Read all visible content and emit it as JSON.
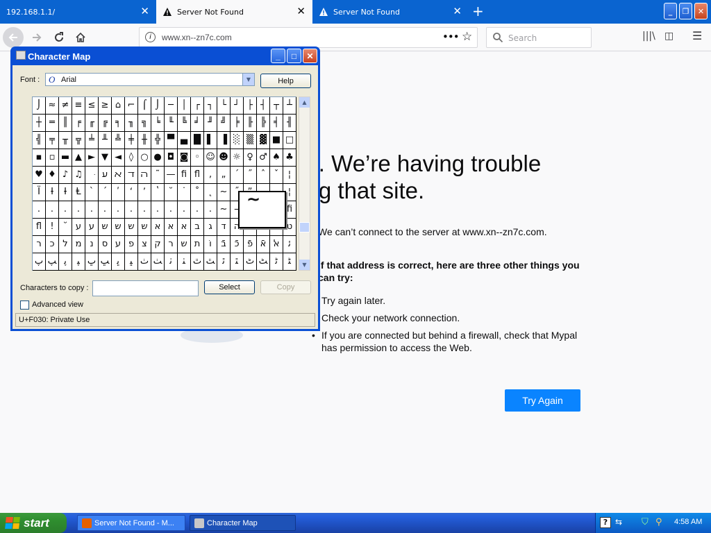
{
  "browser": {
    "tabs": [
      {
        "title": "192.168.1.1/",
        "selected": false
      },
      {
        "title": "Server Not Found",
        "selected": true
      },
      {
        "title": "Server Not Found",
        "selected": false
      }
    ],
    "new_tab_label": "+",
    "url": "www.xn--zn7c.com",
    "search_placeholder": "Search",
    "page_actions_label": "•••",
    "bookmark_star": "☆",
    "accent": "#0a84ff"
  },
  "error_page": {
    "title_line1": "Hmm. We’re having trouble",
    "title_line2": "finding that site.",
    "message": "We can’t connect to the server at www.xn--zn7c.com.",
    "heading": "If that address is correct, here are three other things you can try:",
    "suggestions": [
      "Try again later.",
      "Check your network connection.",
      "If you are connected but behind a firewall, check that Mypal has permission to access the Web."
    ],
    "button_label": "Try Again"
  },
  "charmap": {
    "title": "Character Map",
    "font_label": "Font :",
    "font_value": "Arial",
    "help_label": "Help",
    "chars_to_copy_label": "Characters to copy :",
    "chars_to_copy_value": "",
    "select_label": "Select",
    "copy_label": "Copy",
    "advanced_view_label": "Advanced view",
    "advanced_view_checked": false,
    "status": "U+F030: Private Use",
    "zoom_char": "~",
    "grid": [
      [
        "⌡",
        "≈",
        "≠",
        "≡",
        "≤",
        "≥",
        "⌂",
        "⌐",
        "⌠",
        "⌡",
        "─",
        "│",
        "┌",
        "┐",
        "└",
        "┘",
        "├",
        "┤",
        "┬",
        "┴"
      ],
      [
        "┼",
        "═",
        "║",
        "╒",
        "╓",
        "╔",
        "╕",
        "╖",
        "╗",
        "╘",
        "╙",
        "╚",
        "╛",
        "╜",
        "╝",
        "╞",
        "╟",
        "╠",
        "╡",
        "╢"
      ],
      [
        "╣",
        "╤",
        "╥",
        "╦",
        "╧",
        "╨",
        "╩",
        "╪",
        "╫",
        "╬",
        "▀",
        "▄",
        "█",
        "▌",
        "▐",
        "░",
        "▒",
        "▓",
        "■",
        "□"
      ],
      [
        "▪",
        "▫",
        "▬",
        "▲",
        "►",
        "▼",
        "◄",
        "◊",
        "○",
        "●",
        "◘",
        "◙",
        "◦",
        "☺",
        "☻",
        "☼",
        "♀",
        "♂",
        "♠",
        "♣"
      ],
      [
        "♥",
        "♦",
        "♪",
        "♫",
        "ּ",
        "ﬠ",
        "ﬡ",
        "ﬢ",
        "ﬣ",
        "˜",
        "—",
        "fi",
        "fl",
        "‚",
        "„",
        "´",
        "˝",
        "ˆ",
        "ˇ",
        "¦"
      ],
      [
        "Ï",
        "Ɨ",
        "Ɨ",
        "Ⱡ",
        "ˋ",
        "ˊ",
        "ʹ",
        "ʻ",
        "ʼ",
        "ʽ",
        "˘",
        "˙",
        "˚",
        "˛",
        "~",
        "˝",
        "ˮ",
        "˯",
        "˰",
        "¦"
      ],
      [
        ".",
        ".",
        ".",
        ".",
        ".",
        ".",
        ".",
        ".",
        ".",
        ".",
        ".",
        ".",
        ".",
        ".",
        "~",
        "⎯",
        "·",
        "·",
        "·",
        "fi"
      ],
      [
        "fl",
        "!",
        "˘",
        "ע",
        "ע",
        "ש",
        "ש",
        "ש",
        "ש",
        "א",
        "א",
        "א",
        "ב",
        "ג",
        "ד",
        "ה",
        "ו",
        "ז",
        "ח",
        "ט"
      ],
      [
        "ר",
        "כ",
        "ל",
        "מ",
        "נ",
        "ס",
        "ע",
        "פ",
        "צ",
        "ק",
        "ר",
        "ש",
        "ת",
        "וֹ",
        "בֿ",
        "כֿ",
        "פֿ",
        "אֿ",
        "ﭏ",
        "ﺋ"
      ],
      [
        "ﭖ",
        "ﭗ",
        "ﭘ",
        "ﭙ",
        "ﭚ",
        "ﭛ",
        "ﭜ",
        "ﭝ",
        "ﭞ",
        "ﭟ",
        "ﭠ",
        "ﭡ",
        "ﭢ",
        "ﭣ",
        "ﭤ",
        "ﭥ",
        "ﭦ",
        "ﭧ",
        "ﭨ",
        "ﭩ"
      ]
    ]
  },
  "taskbar": {
    "start_label": "start",
    "tasks": [
      {
        "label": "Server Not Found - M..."
      },
      {
        "label": "Character Map"
      }
    ],
    "clock": "4:58 AM"
  }
}
